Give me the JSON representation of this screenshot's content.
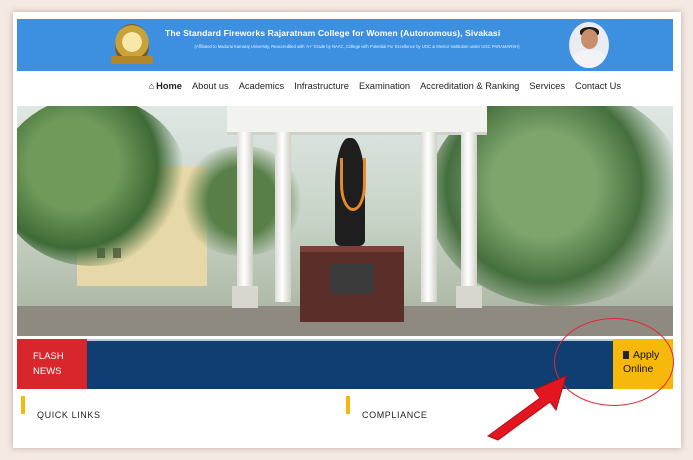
{
  "header": {
    "college_name": "The Standard Fireworks Rajaratnam College for Women (Autonomous), Sivakasi",
    "college_subtitle": "(Affiliated to Madurai Kamaraj University, Reaccredited with 'A+' Grade by NAAC, College with Potential For Excellence by UGC & Mentor Institution under UGC PARAMARSH)"
  },
  "nav": {
    "items": [
      {
        "label": "Home"
      },
      {
        "label": "About us"
      },
      {
        "label": "Academics"
      },
      {
        "label": "Infrastructure"
      },
      {
        "label": "Examination"
      },
      {
        "label": "Accreditation & Ranking"
      },
      {
        "label": "Services"
      },
      {
        "label": "Contact Us"
      }
    ]
  },
  "ticker": {
    "flash_line1": "FLASH",
    "flash_line2": "NEWS",
    "apply_line1": "Apply",
    "apply_line2": "Online"
  },
  "sections": {
    "quick_links": "QUICK LINKS",
    "compliance": "COMPLIANCE"
  },
  "colors": {
    "banner": "#3d8fe0",
    "ticker": "#0f3f72",
    "flash": "#d8262c",
    "apply": "#f5b80b",
    "annotation": "#e32434"
  }
}
